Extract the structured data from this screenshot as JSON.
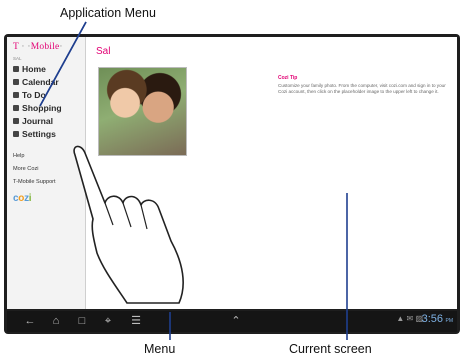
{
  "callouts": {
    "application_menu": "Application Menu",
    "menu": "Menu",
    "current_screen": "Current screen"
  },
  "brand": "T · ·Mobile·",
  "brand_parts": [
    "T",
    " · ·",
    "Mobile",
    "·"
  ],
  "user_sub": "SAL",
  "sidebar": {
    "items": [
      {
        "label": "Home",
        "icon": "home-icon"
      },
      {
        "label": "Calendar",
        "icon": "calendar-icon"
      },
      {
        "label": "To Do",
        "icon": "todo-icon"
      },
      {
        "label": "Shopping",
        "icon": "shopping-icon"
      },
      {
        "label": "Journal",
        "icon": "journal-icon"
      },
      {
        "label": "Settings",
        "icon": "settings-icon"
      }
    ],
    "links": [
      "Help",
      "More Cozi",
      "T-Mobile Support"
    ],
    "logo": "cozi"
  },
  "content": {
    "title": "Sal",
    "tip_title": "Cozi Tip",
    "tip_body": "Customize your family photo. From the computer, visit cozi.com and sign in to your Cozi account, then click on the placeholder image to the upper left to change it."
  },
  "status": {
    "time": "3:56",
    "ampm": "PM"
  },
  "colors": {
    "brand": "#e20074",
    "clock": "#7fb2e5",
    "bar": "#151515",
    "callout_line": "#1f3f8f"
  }
}
